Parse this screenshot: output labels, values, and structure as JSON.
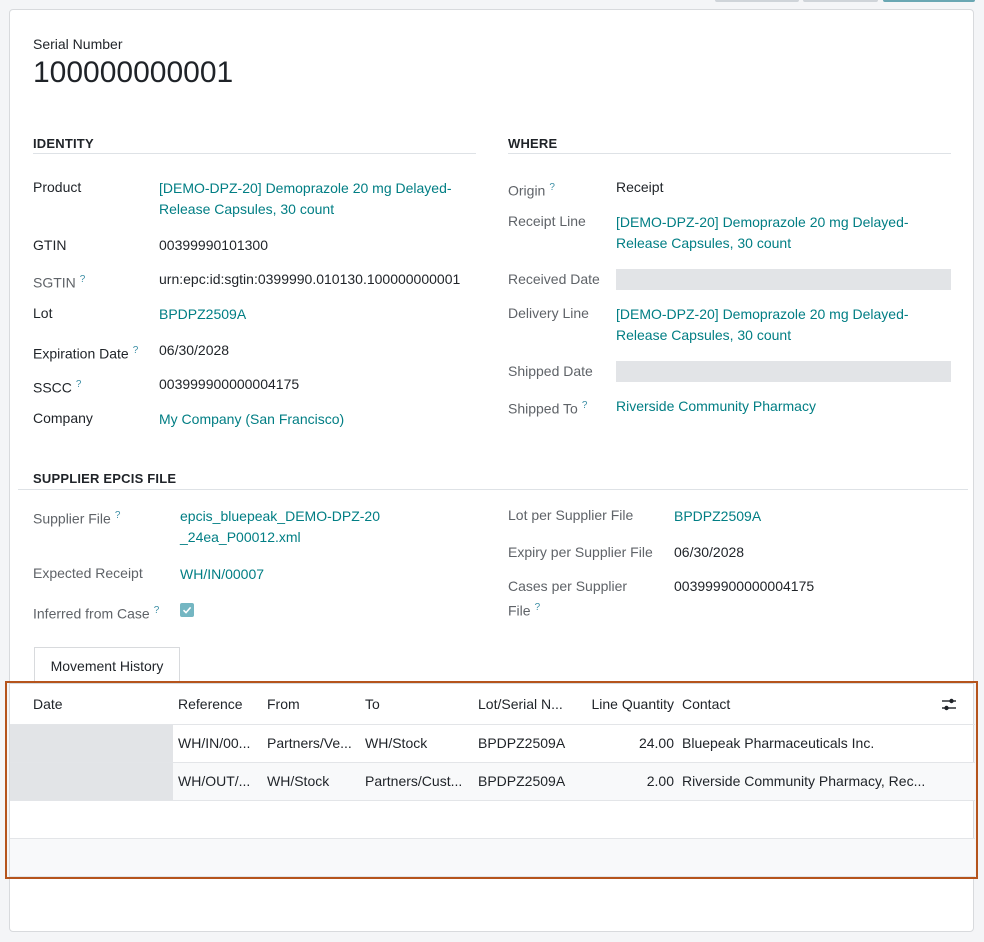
{
  "record": {
    "label": "Serial Number",
    "serial": "100000000001"
  },
  "identity": {
    "title": "IDENTITY",
    "product_label": "Product",
    "product_value": "[DEMO-DPZ-20] Demoprazole 20 mg Delayed-Release Capsules, 30 count",
    "gtin_label": "GTIN",
    "gtin_value": "00399990101300",
    "sgtin_label": "SGTIN",
    "sgtin_value": "urn:epc:id:sgtin:0399990.010130.100000000001",
    "lot_label": "Lot",
    "lot_value": "BPDPZ2509A",
    "expiration_label": "Expiration Date",
    "expiration_value": "06/30/2028",
    "sscc_label": "SSCC",
    "sscc_value": "003999900000004175",
    "company_label": "Company",
    "company_value": "My Company (San Francisco)"
  },
  "where": {
    "title": "WHERE",
    "origin_label": "Origin",
    "origin_value": "Receipt",
    "receipt_line_label": "Receipt Line",
    "receipt_line_value": "[DEMO-DPZ-20] Demoprazole 20 mg Delayed-Release Capsules, 30 count",
    "received_date_label": "Received Date",
    "delivery_line_label": "Delivery Line",
    "delivery_line_value": "[DEMO-DPZ-20] Demoprazole 20 mg Delayed-Release Capsules, 30 count",
    "shipped_date_label": "Shipped Date",
    "shipped_to_label": "Shipped To",
    "shipped_to_value": "Riverside Community Pharmacy"
  },
  "supplier": {
    "title": "SUPPLIER EPCIS FILE",
    "file_label": "Supplier File",
    "file_value": "epcis_bluepeak_DEMO-DPZ-20_24ea_P00012.xml",
    "expected_receipt_label": "Expected Receipt",
    "expected_receipt_value": "WH/IN/00007",
    "inferred_label": "Inferred from Case",
    "inferred_checked": true,
    "lot_label": "Lot per Supplier File",
    "lot_value": "BPDPZ2509A",
    "expiry_label": "Expiry per Supplier File",
    "expiry_value": "06/30/2028",
    "cases_label": "Cases per Supplier File",
    "cases_value": "003999900000004175"
  },
  "tabs": {
    "movement_history": "Movement History"
  },
  "table": {
    "columns": [
      "Date",
      "Reference",
      "From",
      "To",
      "Lot/Serial N...",
      "Line Quantity",
      "Contact"
    ],
    "rows": [
      {
        "date": "",
        "reference": "WH/IN/00...",
        "from": "Partners/Ve...",
        "to": "WH/Stock",
        "lot": "BPDPZ2509A",
        "qty": "24.00",
        "contact": "Bluepeak Pharmaceuticals Inc."
      },
      {
        "date": "",
        "reference": "WH/OUT/...",
        "from": "WH/Stock",
        "to": "Partners/Cust...",
        "lot": "BPDPZ2509A",
        "qty": "2.00",
        "contact": "Riverside Community Pharmacy, Rec..."
      }
    ]
  },
  "icons": {
    "help": "question-mark-icon",
    "column_settings": "sliders-icon",
    "checkbox": "check-icon"
  },
  "colors": {
    "link": "#017e84",
    "highlight_border": "#b5541c",
    "checkbox": "#74b6c2"
  }
}
